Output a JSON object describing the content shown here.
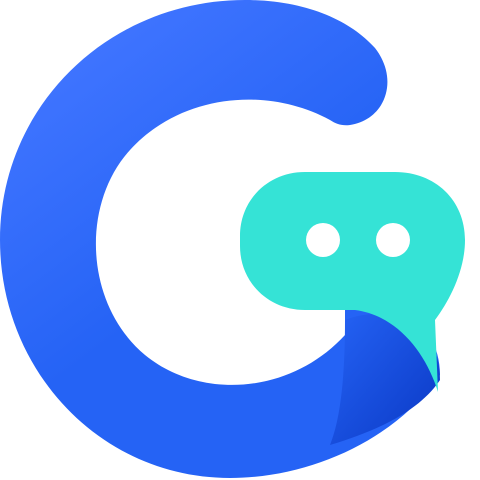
{
  "logo": {
    "name": "g-chat-logo",
    "colors": {
      "ring_light": "#3F74FF",
      "ring_mid": "#2563F5",
      "ring_dark": "#0A38C4",
      "bubble": "#35E3D6",
      "bubble_dots": "#FFFFFF",
      "background": "#FFFFFF"
    },
    "icons": [
      "g-ring-icon",
      "chat-bubble-icon",
      "dot-icon"
    ]
  }
}
